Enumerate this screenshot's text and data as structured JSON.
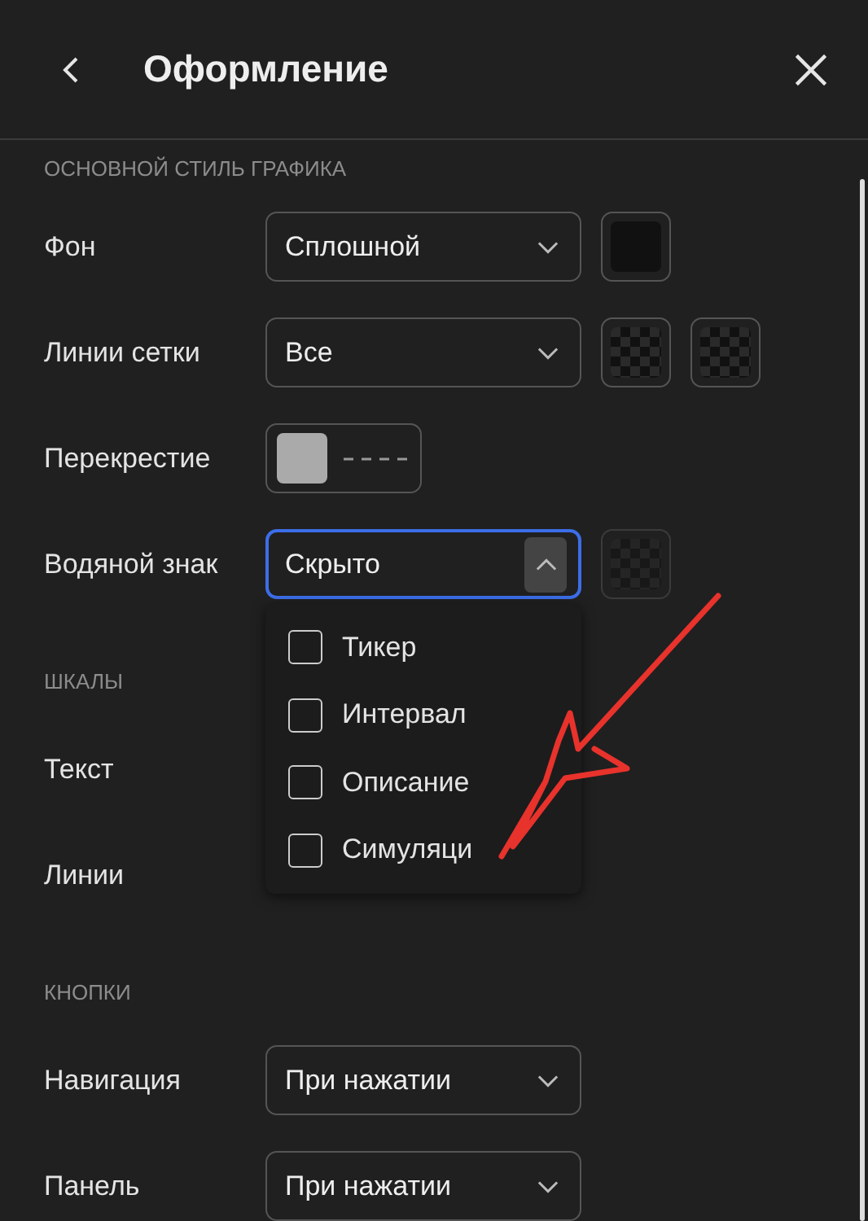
{
  "header": {
    "title": "Оформление"
  },
  "sections": [
    {
      "heading": "ОСНОВНОЙ СТИЛЬ ГРАФИКА",
      "rows": [
        {
          "label": "Фон",
          "control": {
            "kind": "select",
            "value": "Сплошной",
            "open": false
          },
          "swatches": [
            {
              "kind": "solid",
              "disabled": false
            }
          ]
        },
        {
          "label": "Линии сетки",
          "control": {
            "kind": "select",
            "value": "Все",
            "open": false
          },
          "swatches": [
            {
              "kind": "checker",
              "disabled": false
            },
            {
              "kind": "checker",
              "disabled": false
            }
          ]
        },
        {
          "label": "Перекрестие",
          "control": {
            "kind": "crosshair"
          },
          "swatches": []
        },
        {
          "label": "Водяной знак",
          "control": {
            "kind": "select",
            "value": "Скрыто",
            "open": true,
            "menu": [
              {
                "label": "Тикер",
                "checked": false
              },
              {
                "label": "Интервал",
                "checked": false
              },
              {
                "label": "Описание",
                "checked": false
              },
              {
                "label": "Симуляци",
                "checked": false
              }
            ]
          },
          "swatches": [
            {
              "kind": "checker",
              "disabled": true
            }
          ]
        }
      ]
    },
    {
      "heading": "ШКАЛЫ",
      "rows": [
        {
          "label": "Текст",
          "swatches": []
        },
        {
          "label": "Линии",
          "swatches": []
        }
      ]
    },
    {
      "heading": "КНОПКИ",
      "rows": [
        {
          "label": "Навигация",
          "control": {
            "kind": "select",
            "value": "При нажатии",
            "open": false
          },
          "swatches": []
        },
        {
          "label": "Панель",
          "control": {
            "kind": "select",
            "value": "При нажатии",
            "open": false
          },
          "swatches": []
        }
      ]
    }
  ]
}
